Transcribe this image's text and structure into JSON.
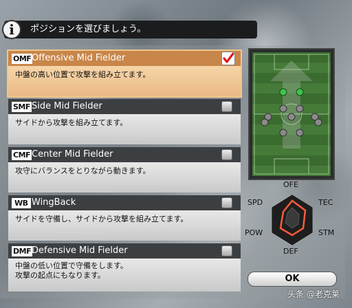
{
  "banner": {
    "text": "ポジションを選びましょう。",
    "icon": "info-icon"
  },
  "positions": [
    {
      "abbr": "OMF",
      "name": "Offensive Mid Fielder",
      "desc": "中盤の高い位置で攻撃を組み立てます。",
      "selected": true
    },
    {
      "abbr": "SMF",
      "name": "Side Mid Fielder",
      "desc": "サイドから攻撃を組み立てます。",
      "selected": false
    },
    {
      "abbr": "CMF",
      "name": "Center Mid Fielder",
      "desc": "攻守にバランスをとりながら動きます。",
      "selected": false
    },
    {
      "abbr": "WB",
      "name": "WingBack",
      "desc": "サイドを守備し、サイドから攻撃を組み立てます。",
      "selected": false
    },
    {
      "abbr": "DMF",
      "name": "Defensive Mid Fielder",
      "desc": "中盤の低い位置で守備をします。\n攻撃の起点にもなります。",
      "selected": false
    }
  ],
  "radar": {
    "labels": {
      "top": "OFE",
      "top_right": "TEC",
      "bottom_right": "STM",
      "bottom": "DEF",
      "bottom_left": "POW",
      "top_left": "SPD"
    }
  },
  "ok_label": "OK",
  "watermark": "头条 @老克莱",
  "colors": {
    "selected_bg": "#f6d5a8",
    "header_bg": "#3c3f42",
    "pitch": "#3a6b2f",
    "highlight_dot": "#3cc44a",
    "radar_line": "#ff5a3c"
  }
}
